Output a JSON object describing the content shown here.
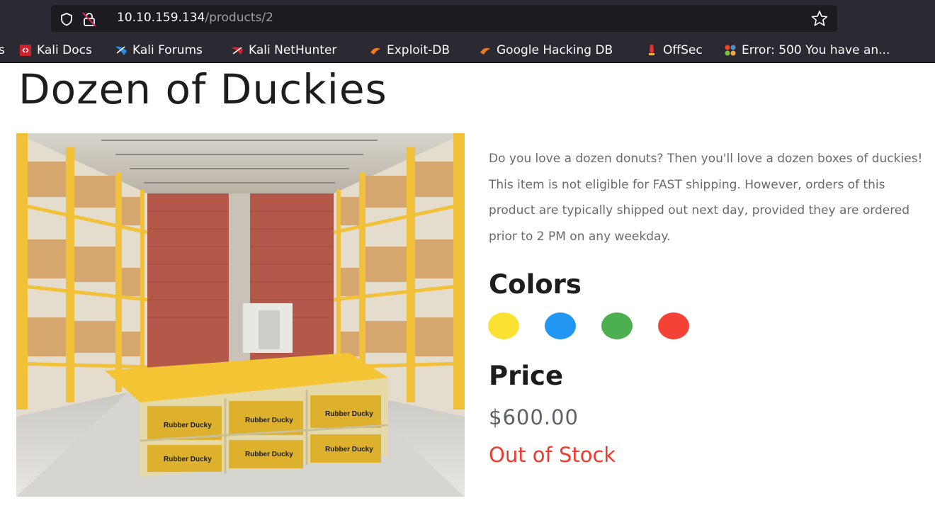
{
  "browser": {
    "url_host": "10.10.159.134",
    "url_path": "/products/2",
    "bookmarks": [
      {
        "label": "s",
        "icon": "none"
      },
      {
        "label": "Kali Docs",
        "icon": "kali-docs-icon"
      },
      {
        "label": "Kali Forums",
        "icon": "kali-forums-icon"
      },
      {
        "label": "Kali NetHunter",
        "icon": "kali-nethunter-icon"
      },
      {
        "label": "Exploit-DB",
        "icon": "exploit-db-icon"
      },
      {
        "label": "Google Hacking DB",
        "icon": "ghdb-icon"
      },
      {
        "label": "OffSec",
        "icon": "offsec-icon"
      },
      {
        "label": "Error: 500 You have an...",
        "icon": "joomla-icon"
      }
    ]
  },
  "product": {
    "title": "Dozen of Duckies",
    "image_box_label": "Rubber Ducky",
    "description": "Do you love a dozen donuts? Then you'll love a dozen boxes of duckies! This item is not eligible for FAST shipping. However, orders of this product are typically shipped out next day, provided they are ordered prior to 2 PM on any weekday.",
    "colors_heading": "Colors",
    "colors": [
      {
        "name": "yellow",
        "hex": "#fbe232"
      },
      {
        "name": "blue",
        "hex": "#2196f3"
      },
      {
        "name": "green",
        "hex": "#4caf50"
      },
      {
        "name": "red",
        "hex": "#f44336"
      }
    ],
    "price_heading": "Price",
    "price": "$600.00",
    "stock_status": "Out of Stock",
    "stock_color": "#ef3b2f"
  }
}
